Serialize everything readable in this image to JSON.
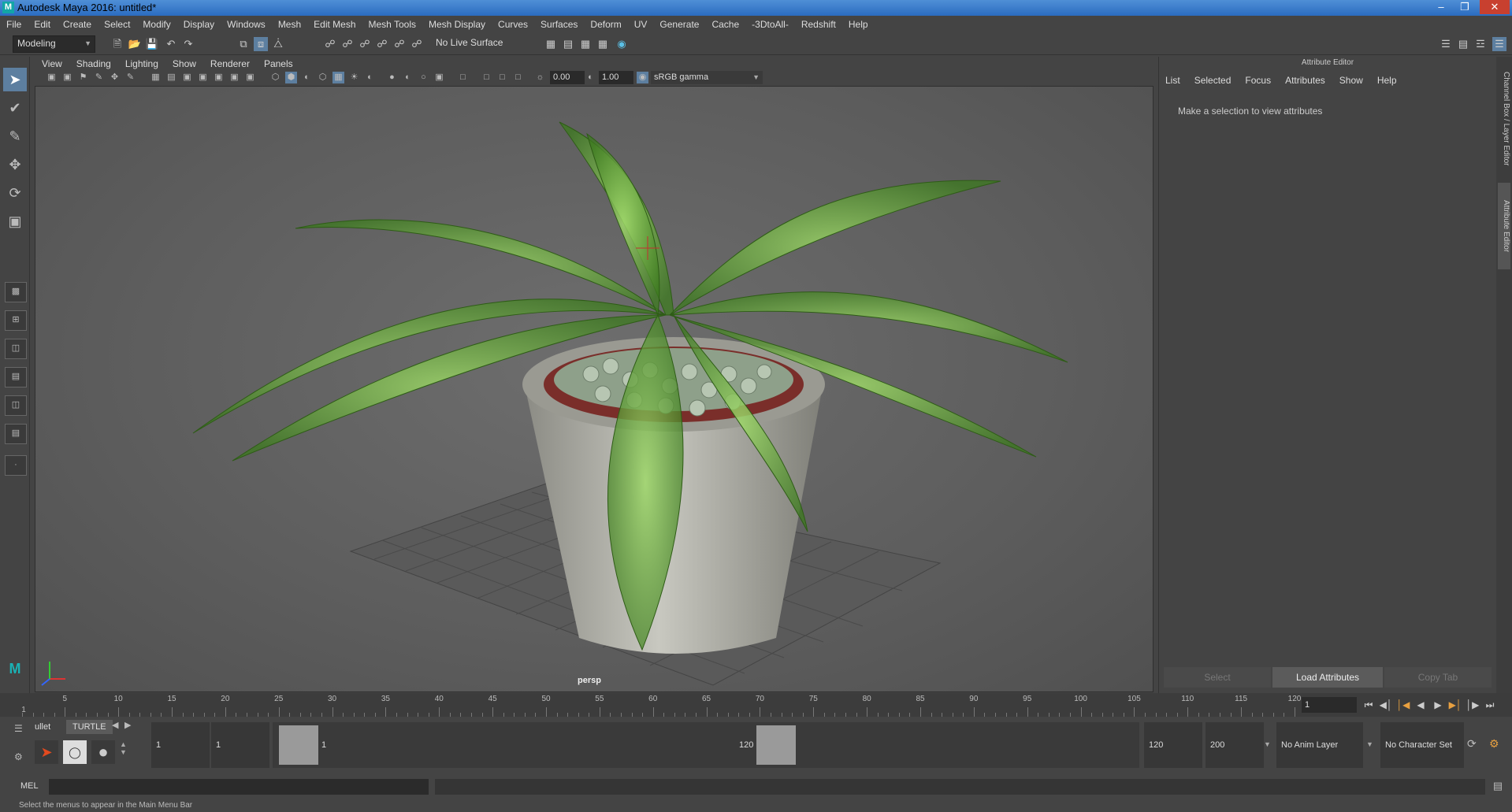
{
  "window": {
    "title": "Autodesk Maya 2016: untitled*"
  },
  "menu": [
    "File",
    "Edit",
    "Create",
    "Select",
    "Modify",
    "Display",
    "Windows",
    "Mesh",
    "Edit Mesh",
    "Mesh Tools",
    "Mesh Display",
    "Curves",
    "Surfaces",
    "Deform",
    "UV",
    "Generate",
    "Cache",
    "-3DtoAll-",
    "Redshift",
    "Help"
  ],
  "toolbar": {
    "mode": "Modeling",
    "live_surface": "No Live Surface"
  },
  "panel": {
    "menu": [
      "View",
      "Shading",
      "Lighting",
      "Show",
      "Renderer",
      "Panels"
    ],
    "exposure": "0.00",
    "gamma": "1.00",
    "color_space": "sRGB gamma",
    "camera": "persp"
  },
  "attribute_editor": {
    "title": "Attribute Editor",
    "menu": [
      "List",
      "Selected",
      "Focus",
      "Attributes",
      "Show",
      "Help"
    ],
    "message": "Make a selection to view attributes",
    "buttons": {
      "select": "Select",
      "load": "Load Attributes",
      "copy_tab": "Copy Tab"
    }
  },
  "side_tabs": {
    "channel_box": "Channel Box / Layer Editor",
    "attribute_editor": "Attribute Editor"
  },
  "timeline": {
    "ticks": [
      "5",
      "10",
      "15",
      "20",
      "25",
      "30",
      "35",
      "40",
      "45",
      "50",
      "55",
      "60",
      "65",
      "70",
      "75",
      "80",
      "85",
      "90",
      "95",
      "100",
      "105",
      "110",
      "115",
      "120"
    ],
    "start_marker": "1",
    "current_frame": "1"
  },
  "range": {
    "start": "1",
    "inner_start": "1",
    "slider_start": "1",
    "slider_end": "120",
    "end": "120",
    "max_end": "200",
    "anim_layer": "No Anim Layer",
    "character_set": "No Character Set"
  },
  "shelf": {
    "tabs": [
      "ullet",
      "TURTLE"
    ]
  },
  "command": {
    "label": "MEL"
  },
  "help_line": "Select the menus to appear in the Main Menu Bar"
}
